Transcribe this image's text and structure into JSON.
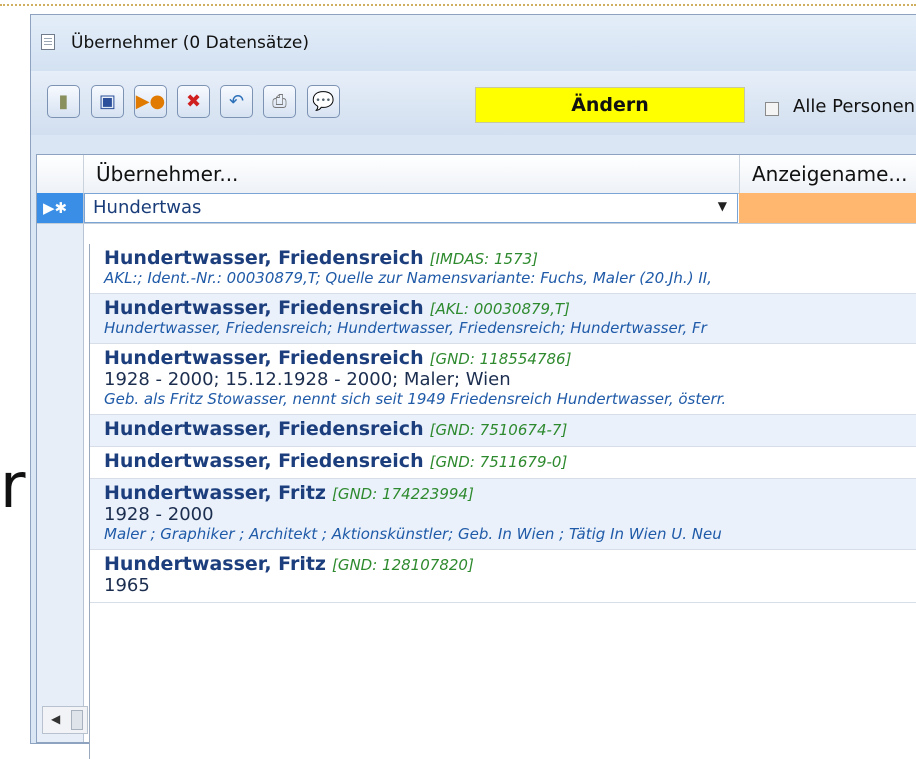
{
  "window": {
    "title": "Übernehmer (0 Datensätze)"
  },
  "toolbar": {
    "buttons": [
      {
        "name": "exit-door-icon",
        "glyph": "▮",
        "color": "#8a8f5e"
      },
      {
        "name": "save-disk-icon",
        "glyph": "▣",
        "color": "#2b4f9a"
      },
      {
        "name": "new-record-icon",
        "glyph": "▶●",
        "color": "#e07a00"
      },
      {
        "name": "delete-x-icon",
        "glyph": "✖",
        "color": "#d01f1f"
      },
      {
        "name": "undo-icon",
        "glyph": "↶",
        "color": "#2a6fb8"
      },
      {
        "name": "print-icon",
        "glyph": "⎙",
        "color": "#777777"
      },
      {
        "name": "comment-icon",
        "glyph": "💬",
        "color": "#a050c8"
      }
    ],
    "status_label": "Ändern",
    "checkbox_label": "Alle Personen"
  },
  "grid": {
    "columns": [
      "Übernehmer...",
      "Anzeigename..."
    ],
    "edit_row_indicator": "▶✱",
    "combo_value": "Hundertwas"
  },
  "dropdown": {
    "items": [
      {
        "name": "Hundertwasser, Friedensreich",
        "tag": "[IMDAS: 1573]",
        "lines": [],
        "note": "AKL:; Ident.-Nr.: 00030879,T; Quelle zur Namensvariante: Fuchs, Maler (20.Jh.) II,"
      },
      {
        "name": "Hundertwasser, Friedensreich",
        "tag": "[AKL: 00030879,T]",
        "lines": [],
        "note": "Hundertwasser, Friedensreich; Hundertwasser, Friedensreich; Hundertwasser, Fr"
      },
      {
        "name": "Hundertwasser, Friedensreich",
        "tag": "[GND: 118554786]",
        "lines": [
          "1928 - 2000; 15.12.1928 - 2000; Maler; Wien"
        ],
        "note": "Geb. als Fritz Stowasser, nennt sich seit 1949 Friedensreich Hundertwasser, österr."
      },
      {
        "name": "Hundertwasser, Friedensreich",
        "tag": "[GND: 7510674-7]",
        "lines": [],
        "note": ""
      },
      {
        "name": "Hundertwasser, Friedensreich",
        "tag": "[GND: 7511679-0]",
        "lines": [],
        "note": ""
      },
      {
        "name": "Hundertwasser, Fritz",
        "tag": "[GND: 174223994]",
        "lines": [
          "1928 - 2000"
        ],
        "note": "Maler ; Graphiker ; Architekt ; Aktionskünstler; Geb. In Wien ; Tätig In Wien U. Neu"
      },
      {
        "name": "Hundertwasser, Fritz",
        "tag": "[GND: 128107820]",
        "lines": [
          "1965"
        ],
        "note": ""
      }
    ]
  },
  "background_glyph": "r",
  "scroll_arrow": "◀"
}
